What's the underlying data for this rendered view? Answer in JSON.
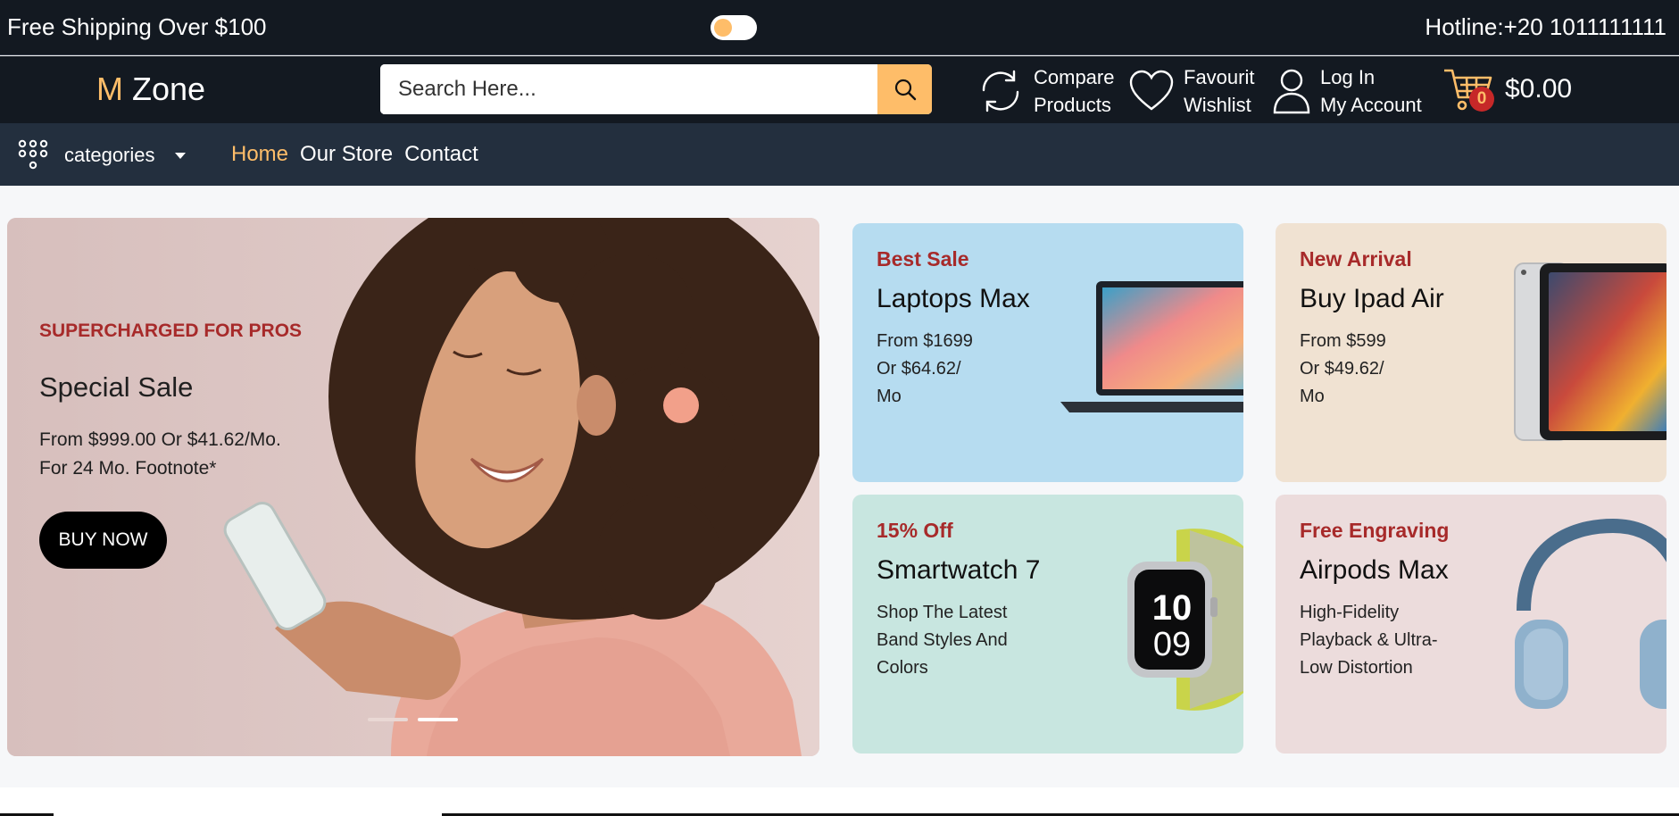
{
  "topbar": {
    "shipping_text": "Free Shipping Over $100",
    "hotline_text": "Hotline:+20 1011111111"
  },
  "header": {
    "logo_m": "M",
    "logo_rest": " Zone",
    "search_placeholder": "Search Here...",
    "compare_line1": "Compare",
    "compare_line2": "Products",
    "wishlist_line1": "Favourit",
    "wishlist_line2": "Wishlist",
    "account_line1": "Log In",
    "account_line2": "My Account",
    "cart_count": "0",
    "cart_total": "$0.00"
  },
  "nav": {
    "categories_label": "categories",
    "links": [
      "Home",
      "Our Store",
      "Contact"
    ],
    "active": "Home"
  },
  "hero": {
    "tag": "SUPERCHARGED FOR PROS",
    "title": "Special Sale",
    "desc_line1": "From $999.00 Or $41.62/Mo.",
    "desc_line2": "For 24 Mo. Footnote*",
    "button": "BUY NOW"
  },
  "cards": [
    {
      "tag": "Best Sale",
      "title": "Laptops Max",
      "lines": [
        "From $1699",
        "Or $64.62/",
        "Mo"
      ]
    },
    {
      "tag": "New Arrival",
      "title": "Buy Ipad Air",
      "lines": [
        "From $599",
        "Or $49.62/",
        "Mo"
      ]
    },
    {
      "tag": "15% Off",
      "title": "Smartwatch 7",
      "lines": [
        "Shop The Latest",
        "Band Styles And",
        "Colors"
      ]
    },
    {
      "tag": "Free Engraving",
      "title": "Airpods Max",
      "lines": [
        "High-Fidelity",
        "Playback & Ultra-",
        "Low Distortion"
      ]
    }
  ],
  "watch_face": {
    "hour": "10",
    "minute": "09"
  },
  "colors": {
    "dark_bg": "#131921",
    "nav_bg": "#232f3e",
    "accent": "#febd69",
    "tag_red": "#a72a2a"
  }
}
